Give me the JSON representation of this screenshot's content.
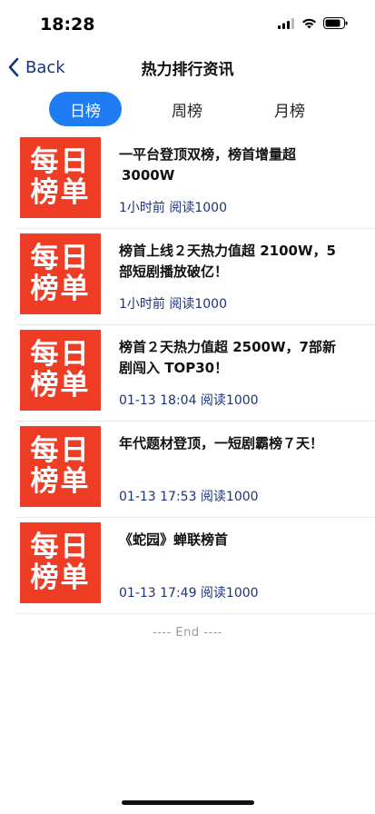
{
  "status_bar": {
    "time": "18:28",
    "icons": [
      "cellular-signal-icon",
      "wifi-icon",
      "battery-icon"
    ]
  },
  "nav": {
    "back_label": "Back",
    "title": "热力排行资讯",
    "back_icon": "chevron-left-icon"
  },
  "tabs": [
    {
      "label": "日榜",
      "active": true
    },
    {
      "label": "周榜",
      "active": false
    },
    {
      "label": "月榜",
      "active": false
    }
  ],
  "items": [
    {
      "thumb_line1": "每日",
      "thumb_line2": "榜单",
      "title_line1": "一平台登顶双榜，榜首增量超",
      "title_line2": "3000W",
      "meta": "1小时前 阅读1000"
    },
    {
      "thumb_line1": "每日",
      "thumb_line2": "榜单",
      "title_line1": "榜首上线２天热力值超 2100W，5",
      "title_line2": "部短剧播放破亿！",
      "meta": "1小时前 阅读1000"
    },
    {
      "thumb_line1": "每日",
      "thumb_line2": "榜单",
      "title_line1": "榜首２天热力值超 2500W，7部新",
      "title_line2": "剧闯入 TOP30！",
      "meta": "01-13 18:04 阅读1000"
    },
    {
      "thumb_line1": "每日",
      "thumb_line2": "榜单",
      "title_line1": "年代题材登顶，一短剧霸榜７天！",
      "title_line2": "",
      "meta": "01-13 17:53 阅读1000"
    },
    {
      "thumb_line1": "每日",
      "thumb_line2": "榜单",
      "title_line1": "《蛇园》蝉联榜首",
      "title_line2": "",
      "meta": "01-13 17:49 阅读1000"
    }
  ],
  "end_text": "---- End ----",
  "colors": {
    "accent": "#1f7cf2",
    "thumb_bg": "#ee3d24",
    "meta_text": "#1c3477"
  }
}
